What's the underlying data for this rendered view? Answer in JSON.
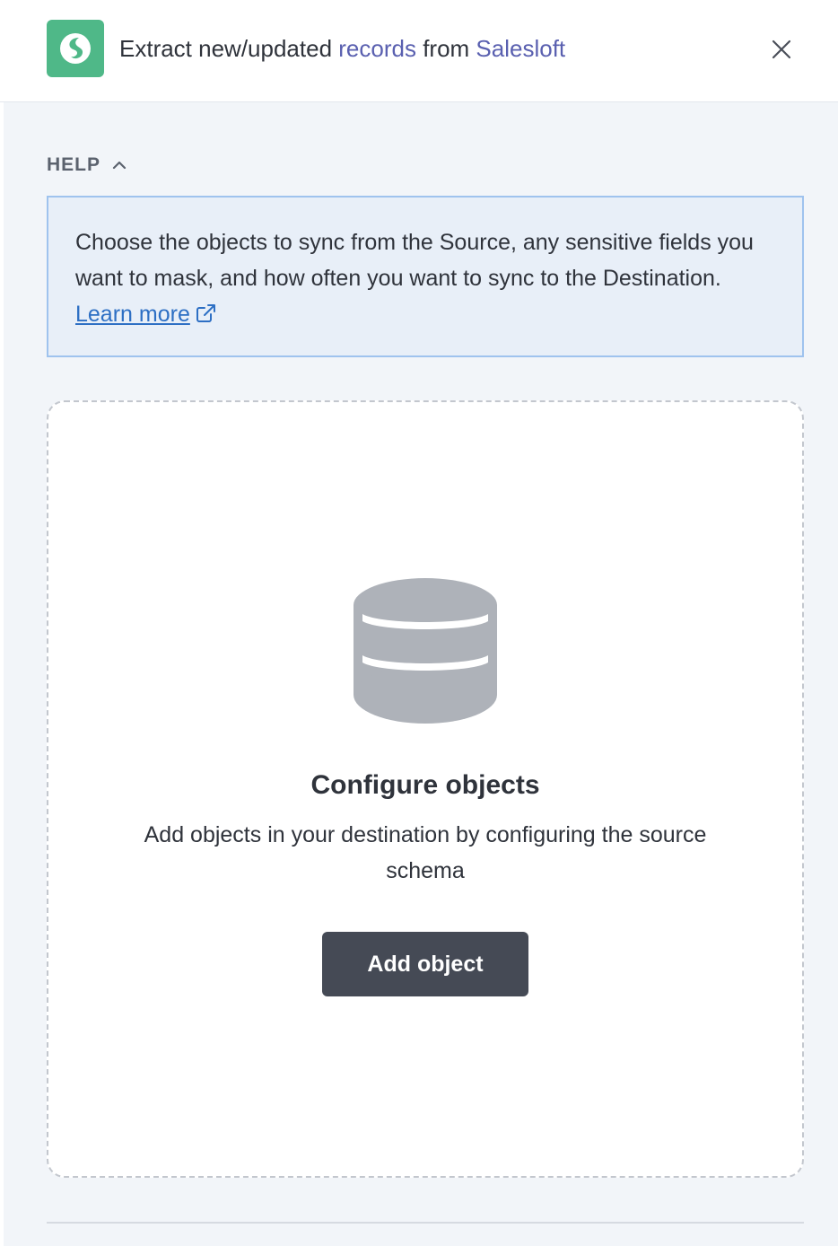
{
  "header": {
    "title_prefix": "Extract new/updated ",
    "title_records": "records",
    "title_mid": " from ",
    "title_source": "Salesloft",
    "logo_color": "#4fb888",
    "link_color": "#5a60b0",
    "close_icon": "close-icon"
  },
  "help": {
    "label": "HELP",
    "chevron": "chevron-up-icon",
    "text": "Choose the objects to sync from the Source, any sensitive fields you want to mask, and how often you want to sync to the Destination. ",
    "link_label": "Learn more",
    "link_icon": "external-link-icon"
  },
  "empty_state": {
    "icon": "database-icon",
    "title": "Configure objects",
    "description": "Add objects in your destination by configuring the source schema",
    "button_label": "Add object"
  }
}
